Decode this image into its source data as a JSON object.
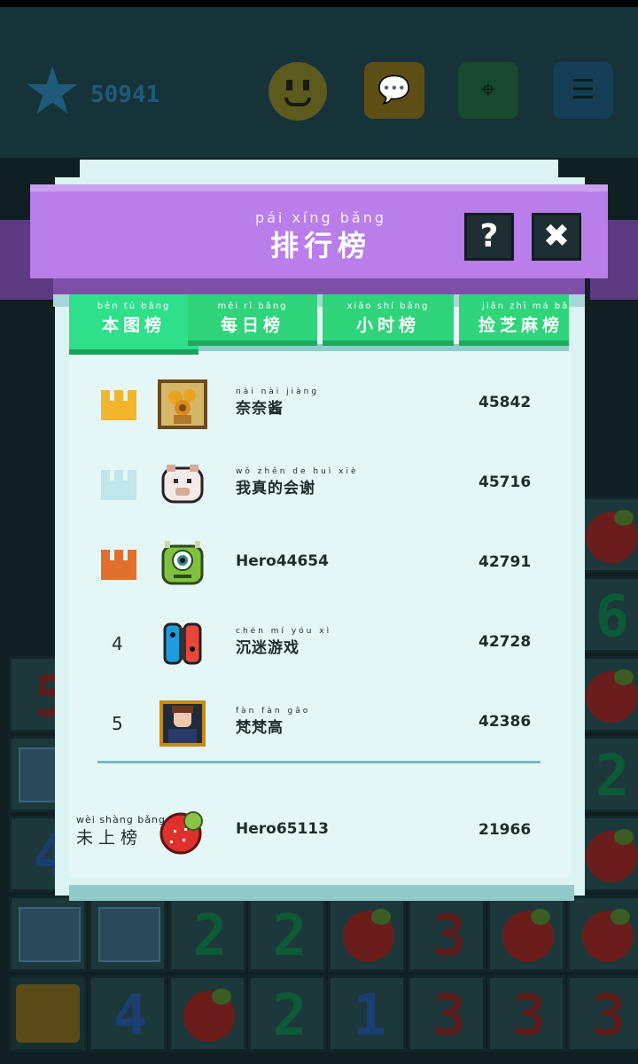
{
  "hud": {
    "score": "50941"
  },
  "board": {
    "visible_numbers": [
      "5",
      "4",
      "6",
      "2",
      "2",
      "2",
      "3",
      "3",
      "4",
      "2",
      "1",
      "3",
      "3",
      "3"
    ]
  },
  "leaderboard": {
    "title_pinyin": "pái xíng bǎng",
    "title": "排行榜",
    "tabs": [
      {
        "pinyin": "běn tú bǎng",
        "label": "本图榜",
        "active": true
      },
      {
        "pinyin": "měi rì bǎng",
        "label": "每日榜",
        "active": false
      },
      {
        "pinyin": "xiǎo shí bǎng",
        "label": "小时榜",
        "active": false
      },
      {
        "pinyin": "jiǎn zhī má bǎ",
        "label": "捡芝麻榜",
        "active": false
      }
    ],
    "entries": [
      {
        "rank": "1",
        "crown_color": "#f2b52b",
        "name_pinyin": "nài nài jiàng",
        "name": "奈奈酱",
        "score": "45842",
        "avatar_icon": "sunflower-painting-icon"
      },
      {
        "rank": "2",
        "crown_color": "#bfe6ea",
        "name_pinyin": "wǒ zhēn de huì xiè",
        "name": "我真的会谢",
        "score": "45716",
        "avatar_icon": "pig-face-icon"
      },
      {
        "rank": "3",
        "crown_color": "#e0702c",
        "name_pinyin": "",
        "name": "Hero44654",
        "score": "42791",
        "avatar_icon": "one-eyed-monster-icon"
      },
      {
        "rank": "4",
        "crown_color": "",
        "name_pinyin": "chén mí yóu xì",
        "name": "沉迷游戏",
        "score": "42728",
        "avatar_icon": "game-console-icon"
      },
      {
        "rank": "5",
        "crown_color": "",
        "name_pinyin": "fàn fàn gāo",
        "name": "梵梵高",
        "score": "42386",
        "avatar_icon": "portrait-painting-icon"
      }
    ],
    "me": {
      "status_pinyin": "wèi shàng bǎng",
      "status": "未上榜",
      "name": "Hero65113",
      "score": "21966",
      "avatar_icon": "strawberry-icon"
    }
  },
  "colors": {
    "header": "#b97ee9",
    "tab": "#2fd47b",
    "panel": "#e4f6f6"
  }
}
